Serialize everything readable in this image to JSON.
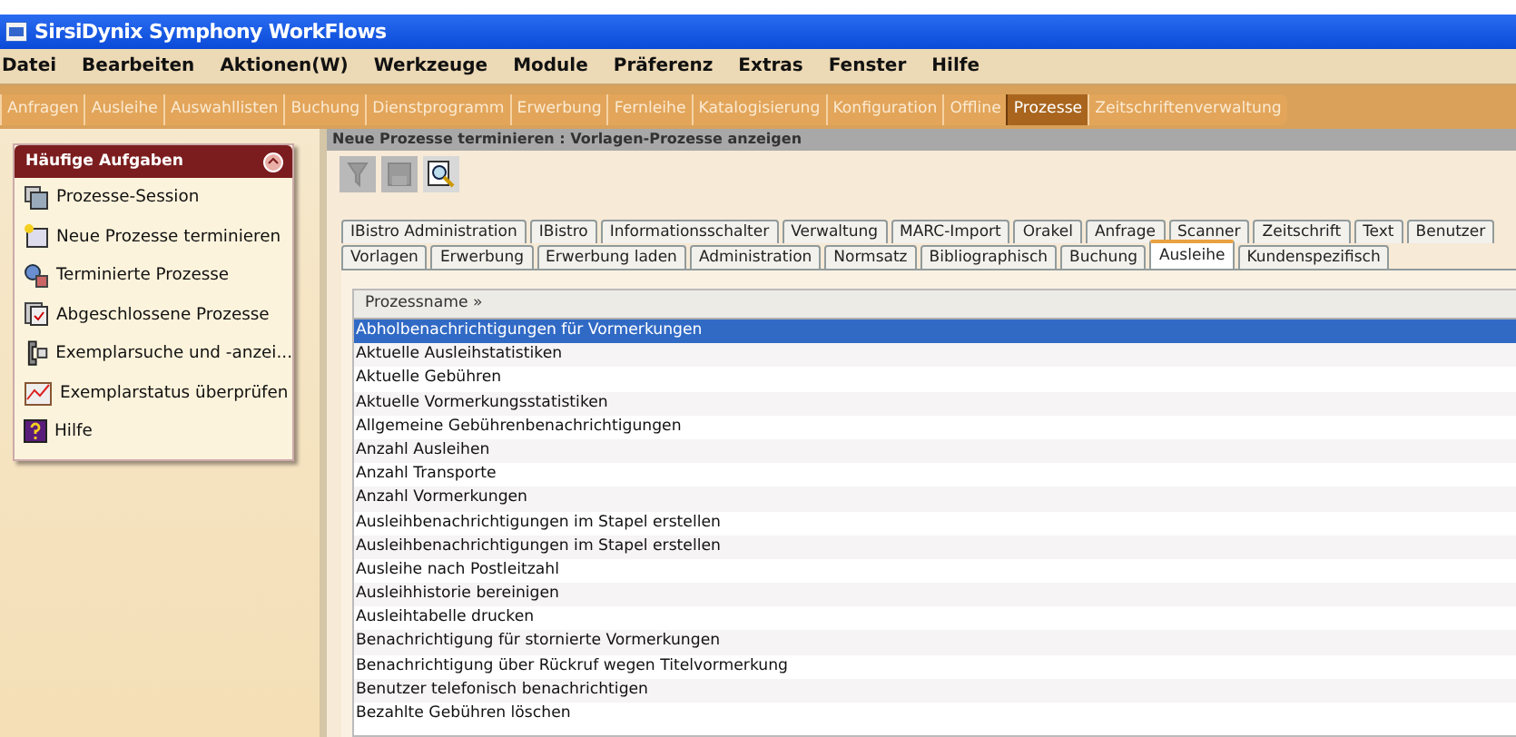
{
  "window": {
    "title": "SirsiDynix Symphony WorkFlows"
  },
  "menu_bar": [
    "Datei",
    "Bearbeiten",
    "Aktionen(W)",
    "Werkzeuge",
    "Module",
    "Präferenz",
    "Extras",
    "Fenster",
    "Hilfe"
  ],
  "module_tabs": [
    {
      "label": "Anfragen",
      "selected": false
    },
    {
      "label": "Ausleihe",
      "selected": false
    },
    {
      "label": "Auswahllisten",
      "selected": false
    },
    {
      "label": "Buchung",
      "selected": false
    },
    {
      "label": "Dienstprogramm",
      "selected": false
    },
    {
      "label": "Erwerbung",
      "selected": false
    },
    {
      "label": "Fernleihe",
      "selected": false
    },
    {
      "label": "Katalogisierung",
      "selected": false
    },
    {
      "label": "Konfiguration",
      "selected": false
    },
    {
      "label": "Offline",
      "selected": false
    },
    {
      "label": "Prozesse",
      "selected": true
    },
    {
      "label": "Zeitschriftenverwaltung",
      "selected": false
    }
  ],
  "sidebar": {
    "title": "Häufige Aufgaben",
    "items": [
      {
        "label": "Prozesse-Session"
      },
      {
        "label": "Neue Prozesse terminieren"
      },
      {
        "label": "Terminierte Prozesse"
      },
      {
        "label": "Abgeschlossene Prozesse"
      },
      {
        "label": "Exemplarsuche und -anzei..."
      },
      {
        "label": "Exemplarstatus überprüfen"
      },
      {
        "label": "Hilfe"
      }
    ]
  },
  "page_header": "Neue Prozesse terminieren : Vorlagen-Prozesse anzeigen",
  "toolbar": [
    {
      "kind": "filter",
      "disabled": true
    },
    {
      "kind": "save",
      "disabled": true
    },
    {
      "kind": "view",
      "disabled": false
    }
  ],
  "tab_rows": [
    [
      {
        "label": "IBistro Administration",
        "selected": false
      },
      {
        "label": "IBistro",
        "selected": false
      },
      {
        "label": "Informationsschalter",
        "selected": false
      },
      {
        "label": "Verwaltung",
        "selected": false
      },
      {
        "label": "MARC-Import",
        "selected": false
      },
      {
        "label": "Orakel",
        "selected": false
      },
      {
        "label": "Anfrage",
        "selected": false
      },
      {
        "label": "Scanner",
        "selected": false
      },
      {
        "label": "Zeitschrift",
        "selected": false
      },
      {
        "label": "Text",
        "selected": false
      },
      {
        "label": "Benutzer",
        "selected": false
      }
    ],
    [
      {
        "label": "Vorlagen",
        "selected": false
      },
      {
        "label": "Erwerbung",
        "selected": false
      },
      {
        "label": "Erwerbung laden",
        "selected": false
      },
      {
        "label": "Administration",
        "selected": false
      },
      {
        "label": "Normsatz",
        "selected": false
      },
      {
        "label": "Bibliographisch",
        "selected": false
      },
      {
        "label": "Buchung",
        "selected": false
      },
      {
        "label": "Ausleihe",
        "selected": true
      },
      {
        "label": "Kundenspezifisch",
        "selected": false
      }
    ]
  ],
  "table": {
    "columns": [
      "Prozessname »"
    ],
    "rows": [
      {
        "name": "Abholbenachrichtigungen für Vormerkungen",
        "selected": true
      },
      {
        "name": "Aktuelle Ausleihstatistiken",
        "selected": false
      },
      {
        "name": "Aktuelle Gebühren",
        "selected": false
      },
      {
        "name": "Aktuelle Vormerkungsstatistiken",
        "selected": false
      },
      {
        "name": "Allgemeine Gebührenbenachrichtigungen",
        "selected": false
      },
      {
        "name": "Anzahl Ausleihen",
        "selected": false
      },
      {
        "name": "Anzahl Transporte",
        "selected": false
      },
      {
        "name": "Anzahl Vormerkungen",
        "selected": false
      },
      {
        "name": "Ausleihbenachrichtigungen im Stapel erstellen",
        "selected": false
      },
      {
        "name": "Ausleihbenachrichtigungen im Stapel erstellen",
        "selected": false
      },
      {
        "name": "Ausleihe nach Postleitzahl",
        "selected": false
      },
      {
        "name": "Ausleihhistorie bereinigen",
        "selected": false
      },
      {
        "name": "Ausleihtabelle drucken",
        "selected": false
      },
      {
        "name": "Benachrichtigung für stornierte Vormerkungen",
        "selected": false
      },
      {
        "name": "Benachrichtigung über Rückruf wegen Titelvormerkung",
        "selected": false
      },
      {
        "name": "Benutzer telefonisch benachrichtigen",
        "selected": false
      },
      {
        "name": "Bezahlte Gebühren löschen",
        "selected": false
      }
    ]
  }
}
